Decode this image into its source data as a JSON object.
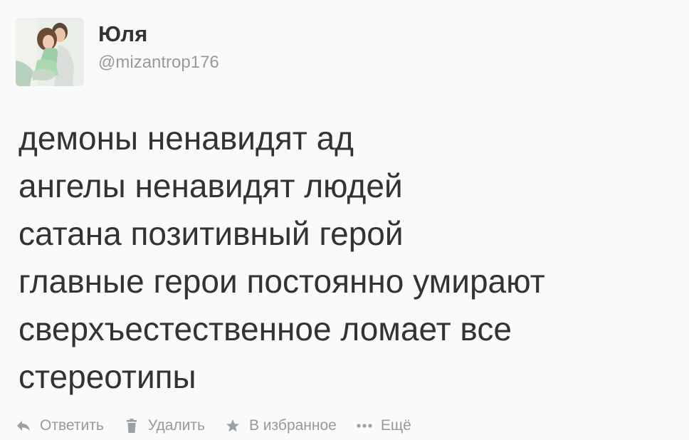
{
  "user": {
    "display_name": "Юля",
    "username": "@mizantrop176"
  },
  "tweet": {
    "lines": [
      "демоны ненавидят ад",
      "ангелы ненавидят людей",
      "сатана позитивный герой",
      "главные герои постоянно умирают",
      "сверхъестественное ломает все",
      "стереотипы"
    ]
  },
  "actions": {
    "reply": {
      "label": "Ответить",
      "icon": "reply-icon"
    },
    "delete": {
      "label": "Удалить",
      "icon": "trash-icon"
    },
    "favorite": {
      "label": "В избранное",
      "icon": "star-icon"
    },
    "more": {
      "label": "Ещё",
      "icon": "more-dots-icon"
    }
  },
  "colors": {
    "text": "#333333",
    "muted": "#999999",
    "background": "#fafafa"
  }
}
